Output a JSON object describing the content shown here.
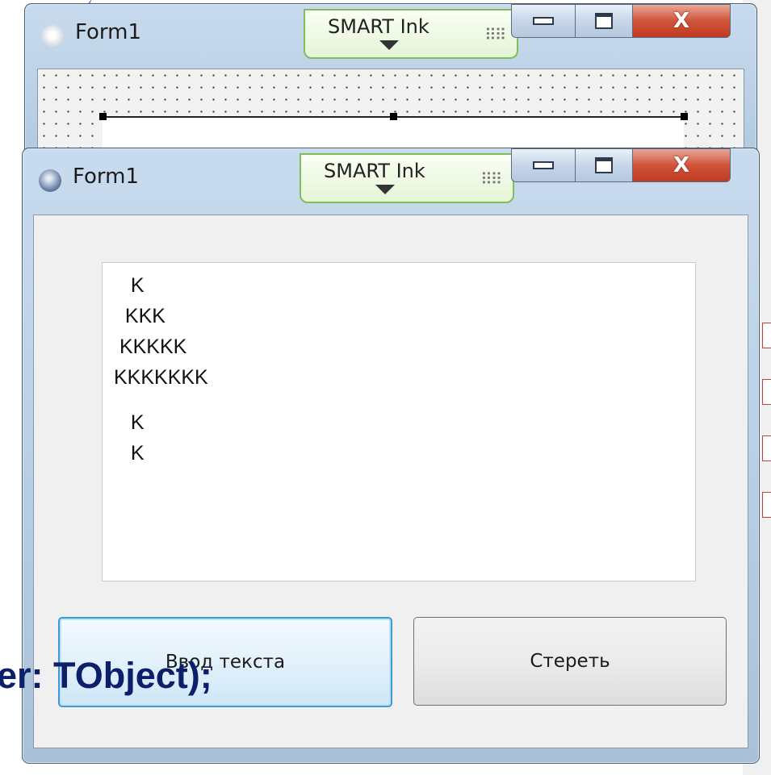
{
  "background": {
    "code_fragment": "er: TObject);"
  },
  "back_window": {
    "title": "Form1",
    "smart_ink_label": "SMART Ink",
    "close_glyph": "X"
  },
  "front_window": {
    "title": "Form1",
    "smart_ink_label": "SMART Ink",
    "close_glyph": "X",
    "memo": {
      "lines": [
        "   K",
        "  KKK",
        " KKKKK",
        "KKKKKKK",
        "   K",
        "   K"
      ]
    },
    "buttons": {
      "input_label": "Ввод текста",
      "clear_label": "Стереть"
    }
  },
  "colors": {
    "close_button": "#c8462c",
    "smart_ink_border": "#7fbf5a",
    "focused_button_border": "#3c9ad6",
    "code_text": "#0b1f6b"
  }
}
